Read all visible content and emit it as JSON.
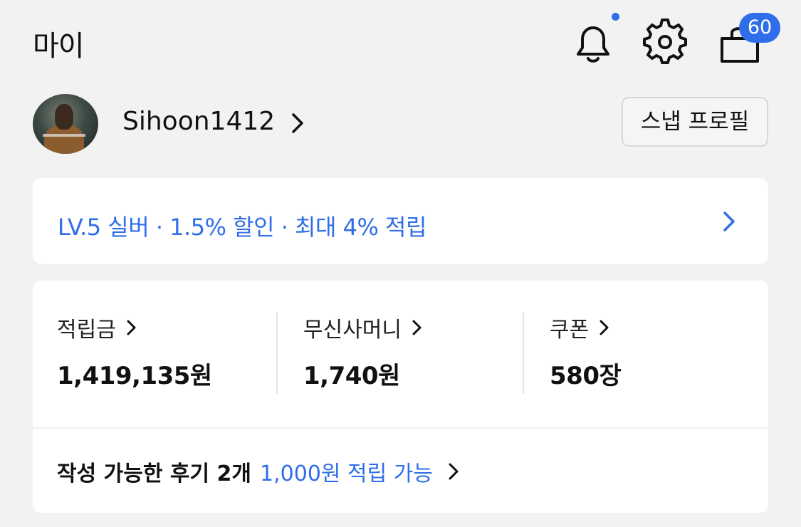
{
  "header": {
    "title": "마이",
    "icons": [
      "bell-icon",
      "gear-icon",
      "shopping-bag-icon"
    ],
    "cart_count": "60",
    "accent_color": "#2f6ee8"
  },
  "profile": {
    "username": "Sihoon1412",
    "snap_profile_label": "스냅 프로필"
  },
  "level": {
    "text": "LV.5 실버 · 1.5% 할인 · 최대 4% 적립"
  },
  "wallet": {
    "items": [
      {
        "label": "적립금",
        "value": "1,419,135원"
      },
      {
        "label": "무신사머니",
        "value": "1,740원"
      },
      {
        "label": "쿠폰",
        "value": "580장"
      }
    ]
  },
  "review": {
    "text": "작성 가능한 후기 2개",
    "reward": "1,000원 적립 가능"
  }
}
